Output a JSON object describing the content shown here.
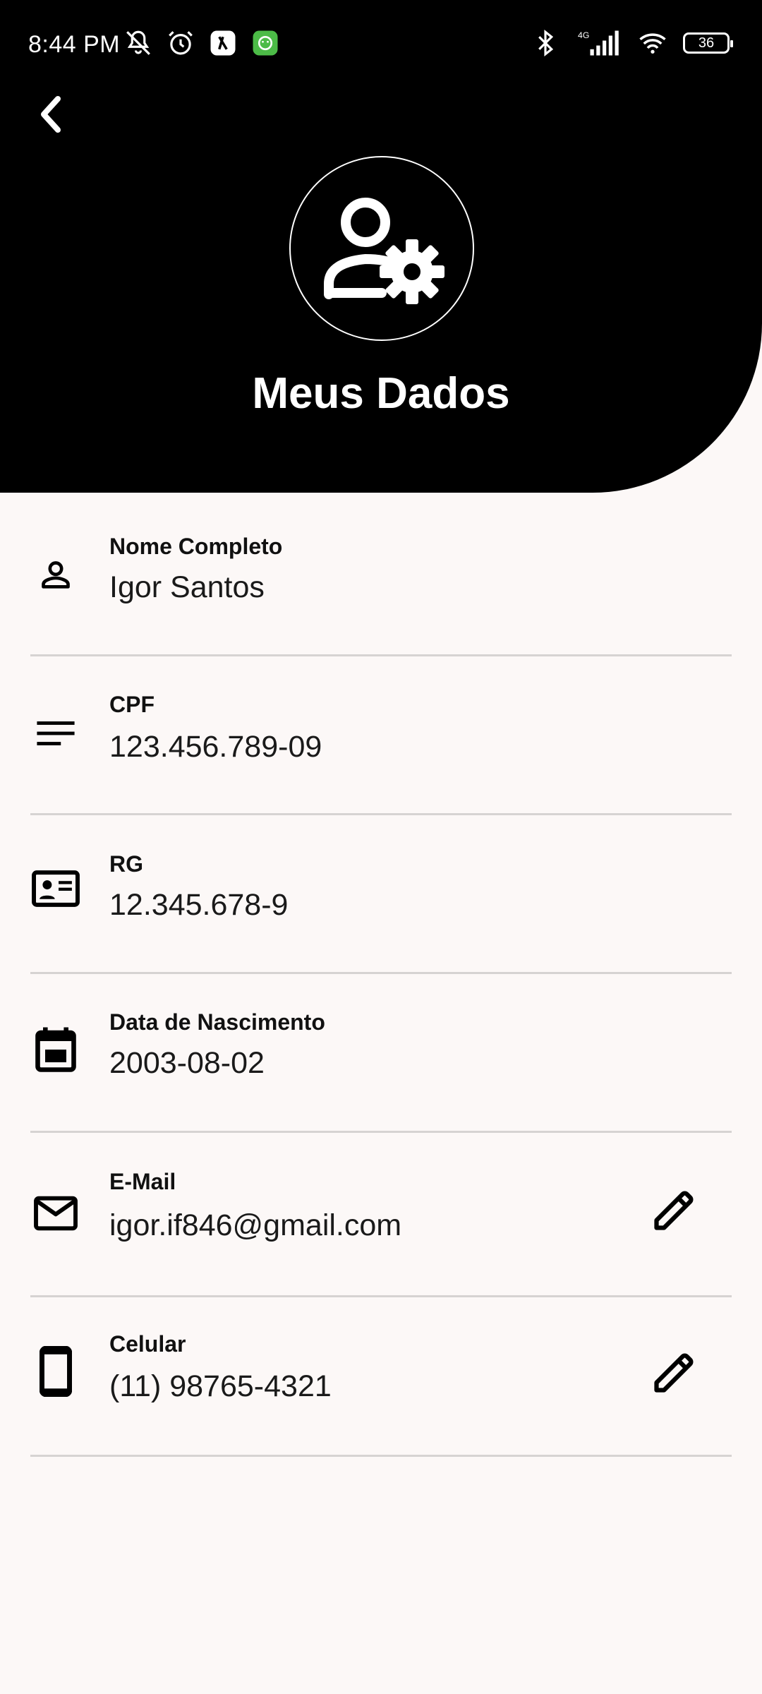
{
  "status_bar": {
    "time": "8:44 PM",
    "network": "4G",
    "battery": "36"
  },
  "header": {
    "title": "Meus Dados",
    "back_icon": "chevron-left-icon",
    "avatar_icon": "manage-account-icon"
  },
  "fields": [
    {
      "label": "Nome Completo",
      "value": "Igor Santos",
      "icon": "person-outline-icon",
      "editable": false
    },
    {
      "label": "CPF",
      "value": "123.456.789-09",
      "icon": "short-text-icon",
      "editable": false
    },
    {
      "label": "RG",
      "value": "12.345.678-9",
      "icon": "id-card-icon",
      "editable": false
    },
    {
      "label": "Data de Nascimento",
      "value": "2003-08-02",
      "icon": "calendar-event-icon",
      "editable": false
    },
    {
      "label": "E-Mail",
      "value": "igor.if846@gmail.com",
      "icon": "mail-outline-icon",
      "editable": true
    },
    {
      "label": "Celular",
      "value": "(11) 98765-4321",
      "icon": "smartphone-icon",
      "editable": true
    }
  ],
  "colors": {
    "header_bg": "#000000",
    "page_bg": "#fcf8f7",
    "divider": "#d6d3d2",
    "text": "#111111"
  }
}
